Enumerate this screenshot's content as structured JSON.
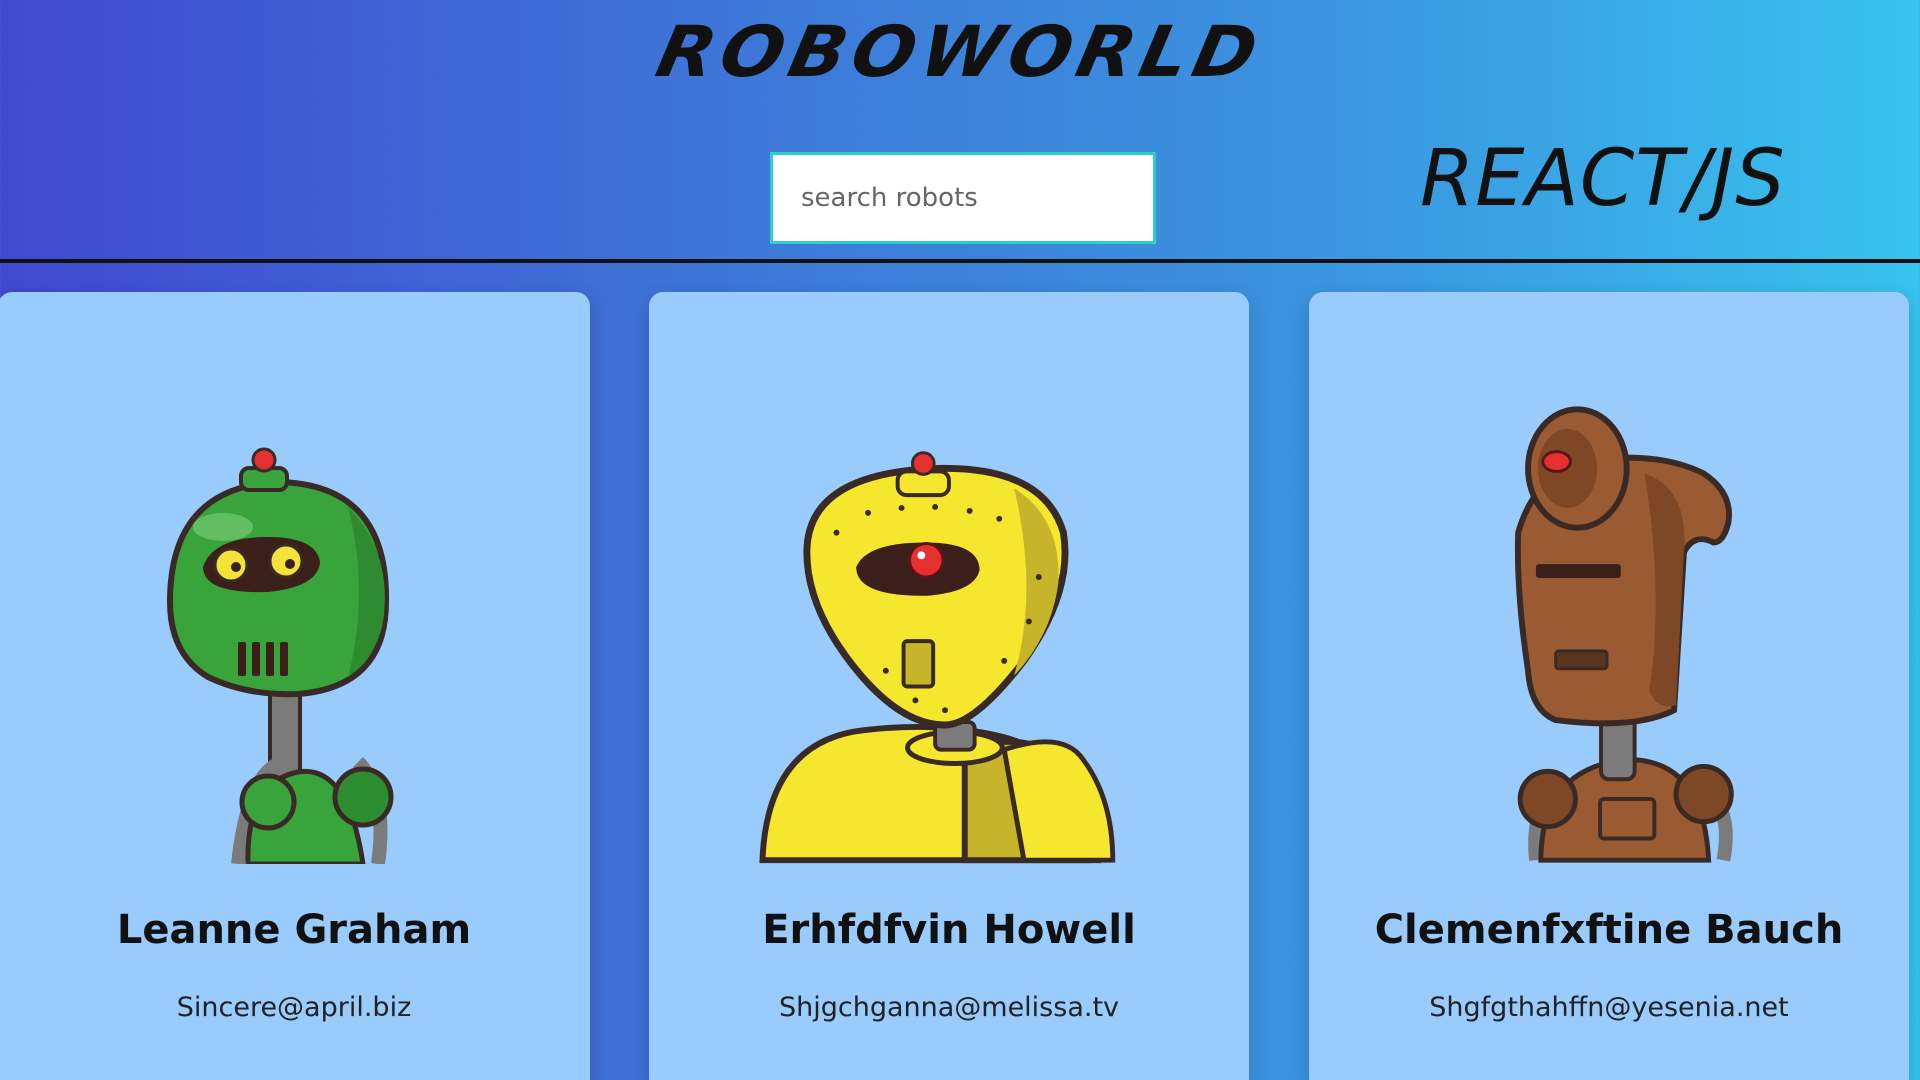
{
  "header": {
    "logo_text": "ROBOWORLD",
    "search_placeholder": "search robots",
    "tech_label": "REACT/JS"
  },
  "robots": [
    {
      "name": "Leanne Graham",
      "email": "Sincere@april.biz",
      "icon": "green-robot-avatar-icon",
      "color": "#3aa43c"
    },
    {
      "name": "Erhfdfvin Howell",
      "email": "Shjgchganna@melissa.tv",
      "icon": "yellow-robot-avatar-icon",
      "color": "#f5e62e"
    },
    {
      "name": "Clemenfxftine Bauch",
      "email": "Shgfgthahffn@yesenia.net",
      "icon": "brown-robot-avatar-icon",
      "color": "#9a5b33"
    }
  ],
  "colors": {
    "card_bg": "#99ccfd",
    "search_border": "#2bd1c4"
  }
}
